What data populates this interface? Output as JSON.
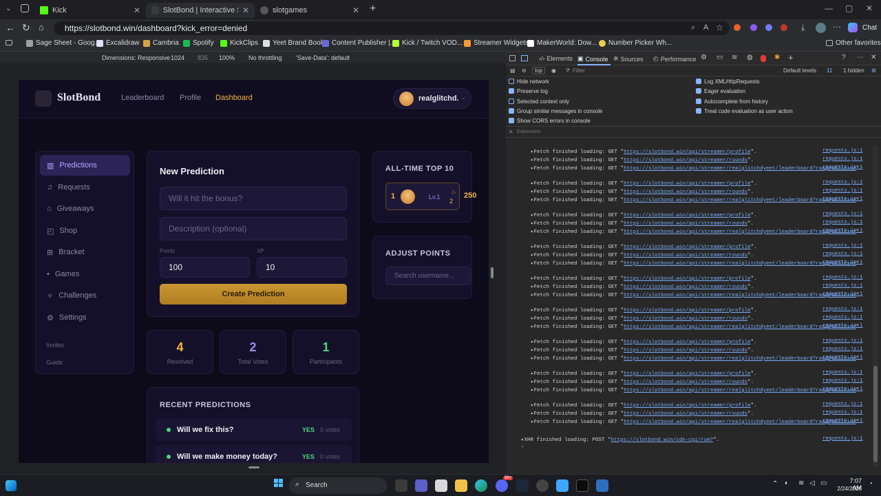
{
  "tabs": [
    {
      "label": "Kick",
      "active": false
    },
    {
      "label": "SlotBond | Interactive Slot Streams",
      "active": true
    },
    {
      "label": "slotgames",
      "active": false
    }
  ],
  "address": {
    "url": "https://slotbond.win/dashboard?kick_error=denied",
    "chat_label": "Chat"
  },
  "bookmarks": [
    "Sage Sheet - Goog...",
    "Excalidraw",
    "Cambria",
    "Spotify",
    "KickClips",
    "Yeet Brand Book",
    "Content Publisher |...",
    "Kick / Twitch VOD...",
    "Streamer Widgets",
    "MakerWorld: Dow...",
    "Number Picker Wh..."
  ],
  "other_favorites": "Other favorites",
  "device_toolbar": {
    "dimensions": "Dimensions: Responsive",
    "width": "1024",
    "height": "835",
    "zoom": "100%",
    "throttle": "No throttling",
    "save_data": "'Save-Data': default"
  },
  "app": {
    "brand": "SlotBond",
    "nav": [
      "Leaderboard",
      "Profile",
      "Dashboard"
    ],
    "user": "realglitchd.",
    "sidebar": [
      "Predictions",
      "Requests",
      "Giveaways",
      "Shop",
      "Bracket",
      "Games",
      "Challenges",
      "Settings"
    ],
    "sidebar_footer": [
      "Invites",
      "Guide"
    ],
    "new_prediction": {
      "title": "New Prediction",
      "question_placeholder": "Will it hit the bonus?",
      "desc_placeholder": "Description (optional)",
      "points_label": "Points",
      "points_value": "100",
      "xp_label": "XP",
      "xp_value": "10",
      "button": "Create Prediction"
    },
    "stats": [
      {
        "value": "4",
        "label": "Resolved",
        "color": "#f0b541"
      },
      {
        "value": "2",
        "label": "Total Votes",
        "color": "#9a8cf0"
      },
      {
        "value": "1",
        "label": "Participants",
        "color": "#4ed57c"
      }
    ],
    "recent": {
      "title": "RECENT PREDICTIONS",
      "items": [
        {
          "q": "Will we fix this?",
          "status": "YES",
          "votes": "0 votes"
        },
        {
          "q": "Will we make money today?",
          "status": "YES",
          "votes": "0 votes"
        }
      ]
    },
    "top10": {
      "title": "ALL-TIME TOP 10",
      "rank": "1",
      "level": "Lv.1",
      "streak": "2",
      "points": "250"
    },
    "adjust": {
      "title": "ADJUST POINTS",
      "placeholder": "Search username..."
    }
  },
  "devtools": {
    "tabs": [
      "Elements",
      "Console",
      "Sources",
      "Performance"
    ],
    "context": "top",
    "filter": "Filter",
    "levels": "Default levels",
    "issues": "11",
    "hidden": "1 hidden",
    "options_left": [
      {
        "label": "Hide network",
        "on": false
      },
      {
        "label": "Preserve log",
        "on": true
      },
      {
        "label": "Selected context only",
        "on": false
      },
      {
        "label": "Group similar messages in console",
        "on": true
      },
      {
        "label": "Show CORS errors in console",
        "on": true
      }
    ],
    "options_right": [
      {
        "label": "Log XMLHttpRequests",
        "on": true
      },
      {
        "label": "Eager evaluation",
        "on": true
      },
      {
        "label": "Autocomplete from history",
        "on": true
      },
      {
        "label": "Treat code evaluation as user action",
        "on": true
      }
    ],
    "expression": "Expression",
    "log_prefix": "Fetch finished loading: GET",
    "urls": [
      "https://slotbond.win/api/streamer/profile",
      "https://slotbond.win/api/streamer/rounds",
      "https://slotbond.win/api/streamer/realglitchdyeet/leaderboard?range=alltime"
    ],
    "src": "requests.js:1",
    "xhr_prefix": "XHR finished loading: POST",
    "xhr_url": "https://slotbond.win/cdn-cgi/rum?"
  },
  "taskbar": {
    "search": "Search",
    "time": "7:07 AM",
    "date": "2/24/2026",
    "badge": "99+"
  }
}
